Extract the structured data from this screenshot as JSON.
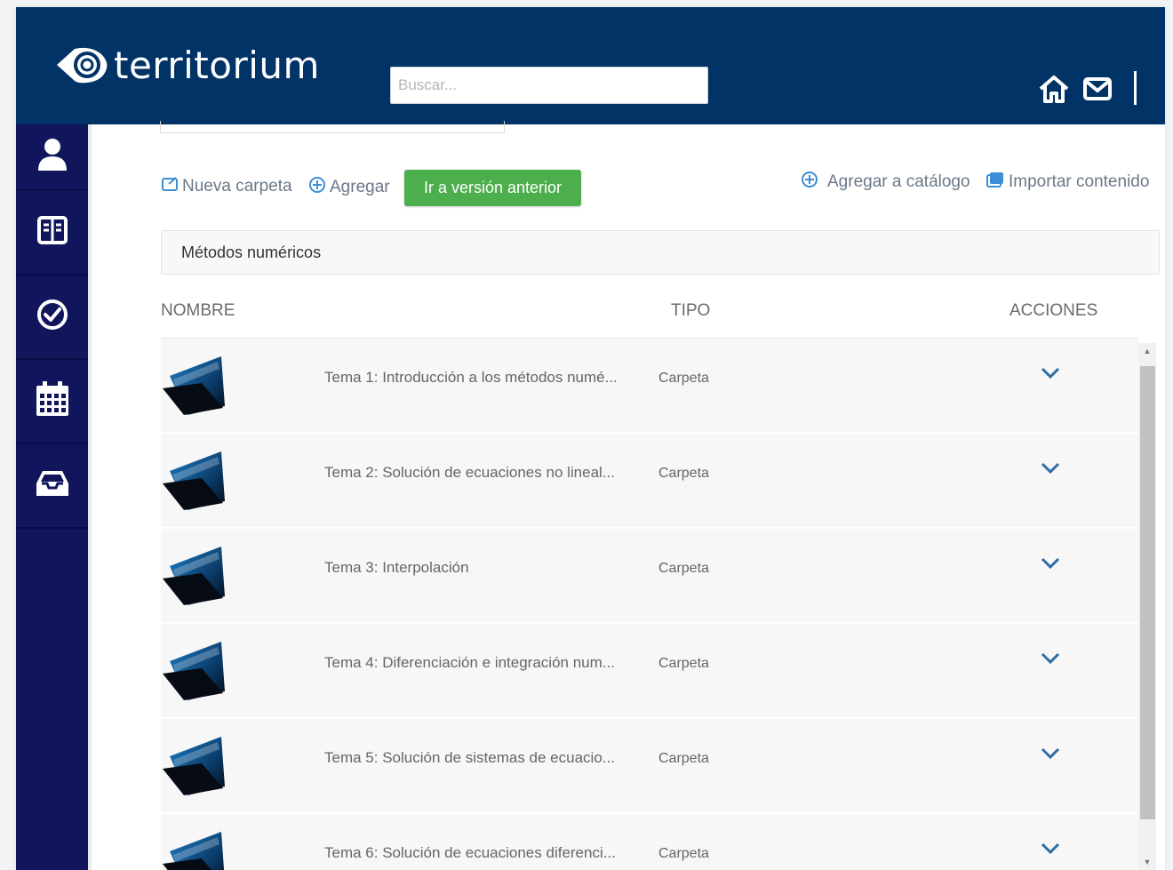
{
  "app": {
    "logo_text": "territorium"
  },
  "header": {
    "search_placeholder": "Buscar...",
    "icons": [
      "home-icon",
      "mail-icon"
    ]
  },
  "sidebar": {
    "items": [
      {
        "icon": "user-icon"
      },
      {
        "icon": "book-icon"
      },
      {
        "icon": "check-circle-icon"
      },
      {
        "icon": "calendar-icon"
      },
      {
        "icon": "inbox-icon"
      }
    ]
  },
  "toolbar": {
    "new_folder": "Nueva carpeta",
    "add": "Agregar",
    "previous_version": "Ir a versión anterior",
    "add_catalog": "Agregar a catálogo",
    "import_content": "Importar contenido"
  },
  "breadcrumb": {
    "current": "Métodos numéricos"
  },
  "table": {
    "columns": {
      "name": "NOMBRE",
      "type": "TIPO",
      "actions": "ACCIONES"
    },
    "rows": [
      {
        "name": "Tema 1: Introducción a los métodos numé...",
        "type": "Carpeta"
      },
      {
        "name": "Tema 2: Solución de ecuaciones no lineal...",
        "type": "Carpeta"
      },
      {
        "name": "Tema 3: Interpolación",
        "type": "Carpeta"
      },
      {
        "name": "Tema 4: Diferenciación e integración num...",
        "type": "Carpeta"
      },
      {
        "name": "Tema 5: Solución de sistemas de ecuacio...",
        "type": "Carpeta"
      },
      {
        "name": "Tema 6: Solución de ecuaciones diferenci...",
        "type": "Carpeta"
      }
    ]
  },
  "colors": {
    "header_bg": "#023366",
    "sidebar_bg": "#10155c",
    "button_green": "#4cae4c",
    "link_blue": "#3a8fd6"
  }
}
